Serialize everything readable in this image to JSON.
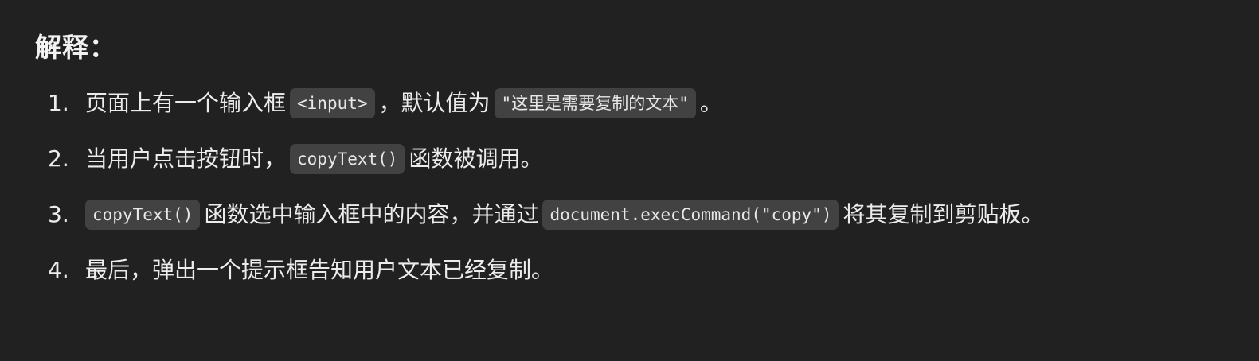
{
  "heading": "解释：",
  "items": [
    {
      "number": "1.",
      "t1": "页面上有一个输入框",
      "c1": "<input>",
      "t2": "，默认值为",
      "c2": "\"这里是需要复制的文本\"",
      "t3": "。"
    },
    {
      "number": "2.",
      "t1": "当用户点击按钮时，",
      "c1": "copyText()",
      "t2": "函数被调用。"
    },
    {
      "number": "3.",
      "c1": "copyText()",
      "t1": "函数选中输入框中的内容，并通过",
      "c2": "document.execCommand(\"copy\")",
      "t2": "将其复制到剪贴板。"
    },
    {
      "number": "4.",
      "t1": "最后，弹出一个提示框告知用户文本已经复制。"
    }
  ]
}
